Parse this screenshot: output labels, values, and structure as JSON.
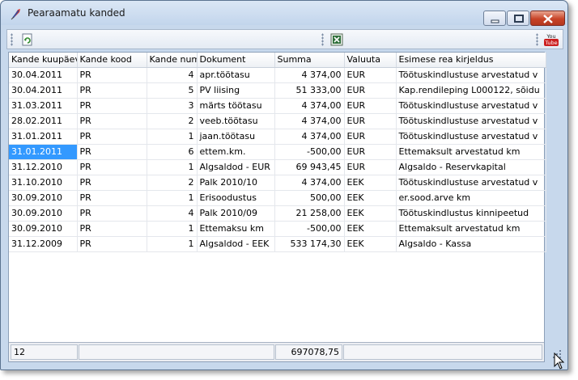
{
  "window": {
    "title": "Pearaamatu kanded"
  },
  "toolbar": {
    "refresh_icon": "refresh-icon",
    "excel_icon": "excel-export-icon",
    "youtube_icon": "youtube-icon"
  },
  "grid": {
    "columns": [
      "Kande kuupäev",
      "Kande kood",
      "Kande number",
      "Dokument",
      "Summa",
      "Valuuta",
      "Esimese rea kirjeldus"
    ],
    "rows": [
      {
        "date": "30.04.2011",
        "code": "PR",
        "num": "4",
        "doc": "apr.töötasu",
        "sum": "4 374,00",
        "cur": "EUR",
        "desc": "Töötuskindlustuse arvestatud v"
      },
      {
        "date": "30.04.2011",
        "code": "PR",
        "num": "5",
        "doc": "PV liising",
        "sum": "51 333,00",
        "cur": "EUR",
        "desc": "Kap.rendileping L000122, sõidu"
      },
      {
        "date": "31.03.2011",
        "code": "PR",
        "num": "3",
        "doc": "märts töötasu",
        "sum": "4 374,00",
        "cur": "EUR",
        "desc": "Töötuskindlustuse arvestatud v"
      },
      {
        "date": "28.02.2011",
        "code": "PR",
        "num": "2",
        "doc": "veeb.töötasu",
        "sum": "4 374,00",
        "cur": "EUR",
        "desc": "Töötuskindlustuse arvestatud v"
      },
      {
        "date": "31.01.2011",
        "code": "PR",
        "num": "1",
        "doc": "jaan.töötasu",
        "sum": "4 374,00",
        "cur": "EUR",
        "desc": "Töötuskindlustuse arvestatud v"
      },
      {
        "date": "31.01.2011",
        "code": "PR",
        "num": "6",
        "doc": "ettem.km.",
        "sum": "-500,00",
        "cur": "EUR",
        "desc": "Ettemaksult arvestatud km"
      },
      {
        "date": "31.12.2010",
        "code": "PR",
        "num": "1",
        "doc": "Algsaldod - EUR",
        "sum": "69 943,45",
        "cur": "EUR",
        "desc": "Algsaldo - Reservkapital"
      },
      {
        "date": "31.10.2010",
        "code": "PR",
        "num": "2",
        "doc": "Palk 2010/10",
        "sum": "4 374,00",
        "cur": "EEK",
        "desc": "Töötuskindlustuse arvestatud v"
      },
      {
        "date": "30.09.2010",
        "code": "PR",
        "num": "1",
        "doc": "Erisoodustus",
        "sum": "500,00",
        "cur": "EEK",
        "desc": "er.sood.arve km"
      },
      {
        "date": "30.09.2010",
        "code": "PR",
        "num": "4",
        "doc": "Palk 2010/09",
        "sum": "21 258,00",
        "cur": "EEK",
        "desc": "Töötuskindlustus kinnipeetud"
      },
      {
        "date": "30.09.2010",
        "code": "PR",
        "num": "1",
        "doc": "Ettemaksu km",
        "sum": "-500,00",
        "cur": "EEK",
        "desc": "Ettemaksult arvestatud km"
      },
      {
        "date": "31.12.2009",
        "code": "PR",
        "num": "1",
        "doc": "Algsaldod - EEK",
        "sum": "533 174,30",
        "cur": "EEK",
        "desc": "Algsaldo -  Kassa"
      }
    ],
    "selected_row": 5
  },
  "footer": {
    "count": "12",
    "total": "697078,75"
  },
  "colors": {
    "selection": "#3399ff",
    "window_frame": "#c7d8ec",
    "close_button": "#c84428"
  }
}
